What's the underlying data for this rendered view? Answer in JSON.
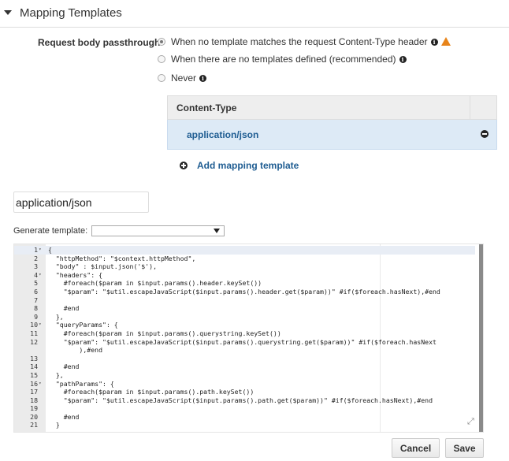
{
  "section": {
    "title": "Mapping Templates"
  },
  "passthrough": {
    "label": "Request body passthrough",
    "options": [
      {
        "label": "When no template matches the request Content-Type header",
        "selected": true,
        "info": true,
        "warning": true
      },
      {
        "label": "When there are no templates defined (recommended)",
        "selected": false,
        "info": true,
        "warning": false
      },
      {
        "label": "Never",
        "selected": false,
        "info": true,
        "warning": false
      }
    ]
  },
  "content_types": {
    "header": "Content-Type",
    "rows": [
      {
        "value": "application/json"
      }
    ],
    "add_label": "Add mapping template"
  },
  "content_type_input": {
    "value": "application/json"
  },
  "generate": {
    "label": "Generate template:",
    "selected": ""
  },
  "editor": {
    "lines": [
      {
        "n": "1",
        "fold": true,
        "code": "{"
      },
      {
        "n": "2",
        "fold": false,
        "code": "  \"httpMethod\": \"$context.httpMethod\","
      },
      {
        "n": "3",
        "fold": false,
        "code": "  \"body\" : $input.json('$'),"
      },
      {
        "n": "4",
        "fold": true,
        "code": "  \"headers\": {"
      },
      {
        "n": "5",
        "fold": false,
        "code": "    #foreach($param in $input.params().header.keySet())"
      },
      {
        "n": "6",
        "fold": false,
        "code": "    \"$param\": \"$util.escapeJavaScript($input.params().header.get($param))\" #if($foreach.hasNext),#end"
      },
      {
        "n": "7",
        "fold": false,
        "code": ""
      },
      {
        "n": "8",
        "fold": false,
        "code": "    #end"
      },
      {
        "n": "9",
        "fold": false,
        "code": "  },"
      },
      {
        "n": "10",
        "fold": true,
        "code": "  \"queryParams\": {"
      },
      {
        "n": "11",
        "fold": false,
        "code": "    #foreach($param in $input.params().querystring.keySet())"
      },
      {
        "n": "12",
        "fold": false,
        "code": "    \"$param\": \"$util.escapeJavaScript($input.params().querystring.get($param))\" #if($foreach.hasNext"
      },
      {
        "n": "",
        "fold": false,
        "code": "        ),#end"
      },
      {
        "n": "13",
        "fold": false,
        "code": ""
      },
      {
        "n": "14",
        "fold": false,
        "code": "    #end"
      },
      {
        "n": "15",
        "fold": false,
        "code": "  },"
      },
      {
        "n": "16",
        "fold": true,
        "code": "  \"pathParams\": {"
      },
      {
        "n": "17",
        "fold": false,
        "code": "    #foreach($param in $input.params().path.keySet())"
      },
      {
        "n": "18",
        "fold": false,
        "code": "    \"$param\": \"$util.escapeJavaScript($input.params().path.get($param))\" #if($foreach.hasNext),#end"
      },
      {
        "n": "19",
        "fold": false,
        "code": ""
      },
      {
        "n": "20",
        "fold": false,
        "code": "    #end"
      },
      {
        "n": "21",
        "fold": false,
        "code": "  }"
      }
    ]
  },
  "buttons": {
    "cancel": "Cancel",
    "save": "Save"
  }
}
